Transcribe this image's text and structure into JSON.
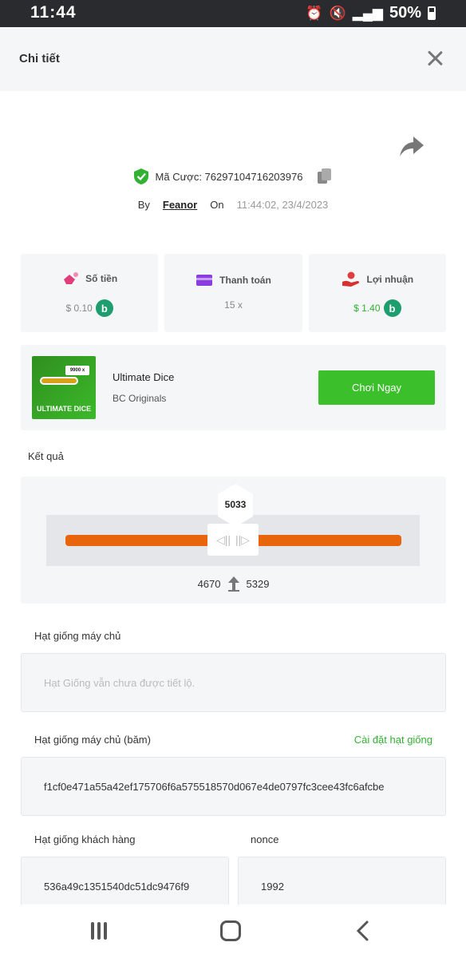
{
  "status_bar": {
    "time": "11:44",
    "battery": "50%"
  },
  "header": {
    "title": "Chi tiết"
  },
  "bet": {
    "id_label": "Mã Cược: 76297104716203976",
    "by_label": "By",
    "user": "Feanor",
    "on_label": "On",
    "datetime": "11:44:02, 23/4/2023"
  },
  "stats": {
    "amount": {
      "label": "Số tiền",
      "value": "$ 0.10",
      "coin": "b"
    },
    "payout": {
      "label": "Thanh toán",
      "value": "15 x"
    },
    "profit": {
      "label": "Lợi nhuận",
      "value": "$ 1.40",
      "coin": "b"
    }
  },
  "game": {
    "name": "Ultimate Dice",
    "provider": "BC Originals",
    "thumb_text": "ULTIMATE DICE",
    "thumb_tag": "9900 x",
    "play_label": "Chơi Ngay"
  },
  "result": {
    "label": "Kết quả",
    "value": "5033",
    "range_low": "4670",
    "range_high": "5329"
  },
  "server_seed": {
    "label": "Hạt giống máy chủ",
    "placeholder": "Hạt Giống vẫn chưa được tiết lộ."
  },
  "server_seed_hash": {
    "label": "Hạt giống máy chủ (băm)",
    "link": "Cài đặt hạt giống",
    "value": "f1cf0e471a55a42ef175706f6a575518570d067e4de0797fc3cee43fc6afcbe"
  },
  "client_seed": {
    "label": "Hạt giống khách hàng",
    "value": "536a49c1351540dc51dc9476f9"
  },
  "nonce": {
    "label": "nonce",
    "value": "1992"
  },
  "colors": {
    "accent_green": "#3bc02b",
    "slider_orange": "#e8650c",
    "coin_teal": "#1e9e6e"
  }
}
